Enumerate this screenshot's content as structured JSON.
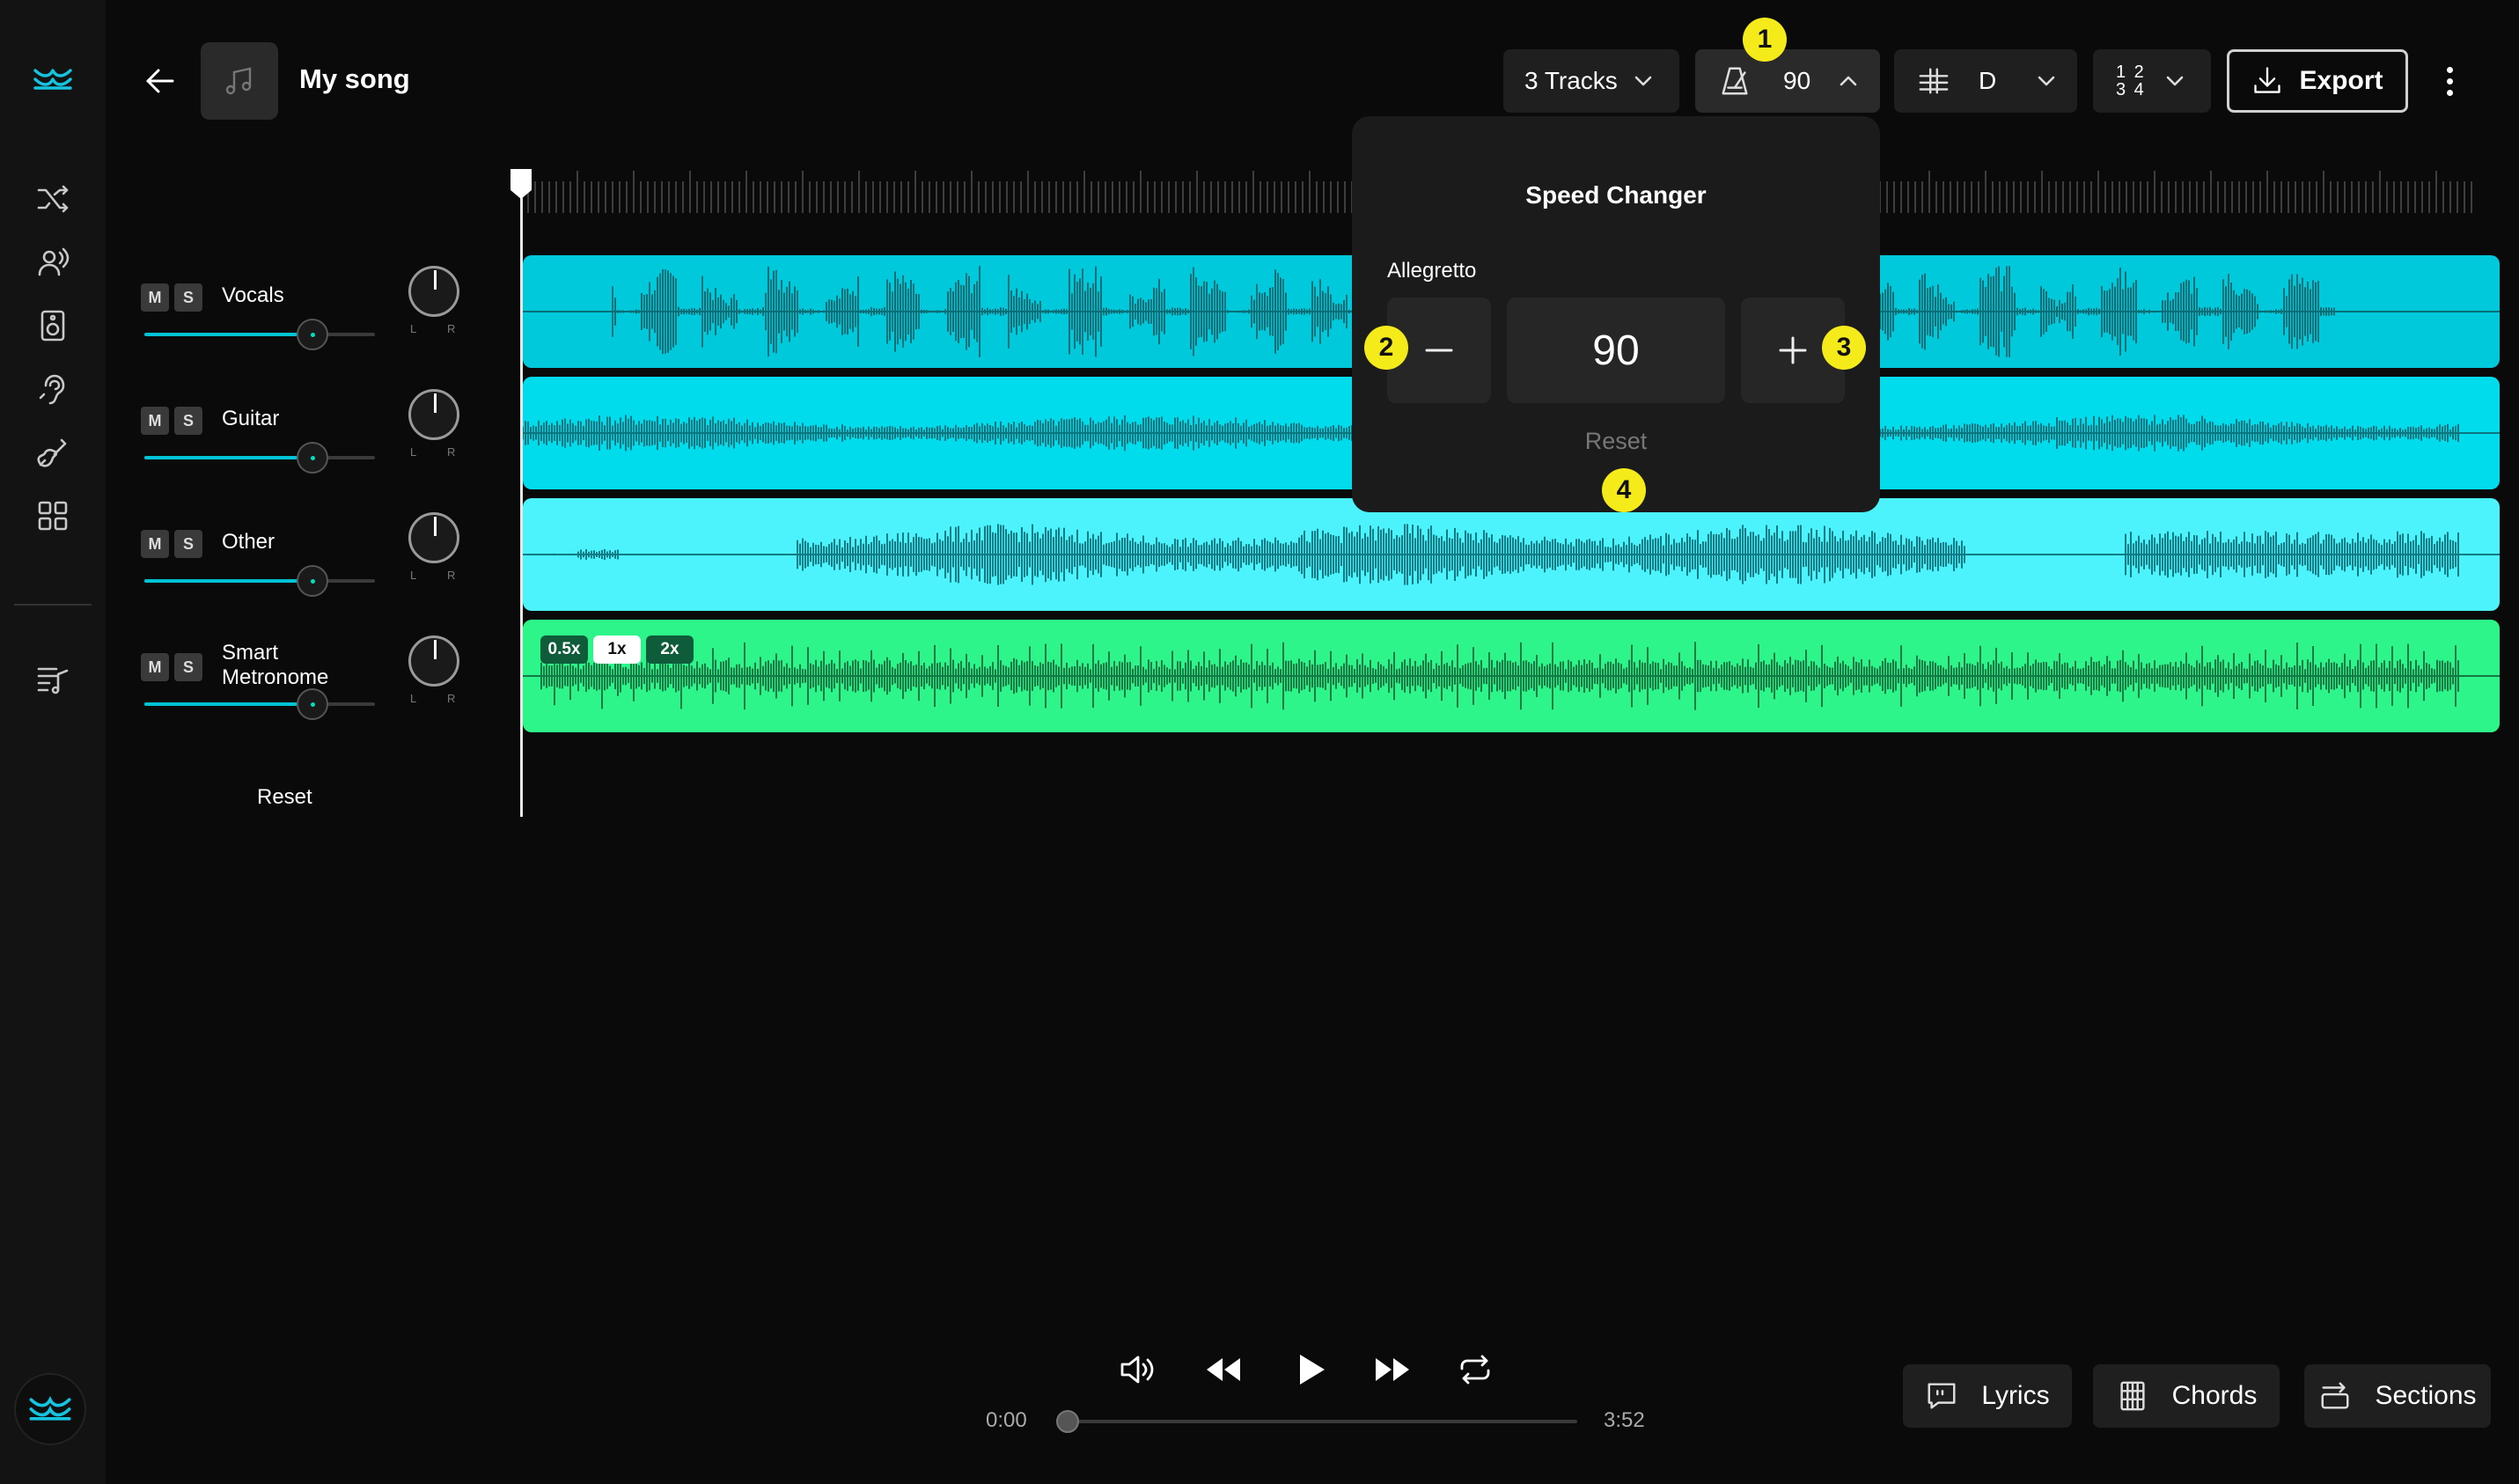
{
  "header": {
    "song_title": "My song",
    "tracks_label": "3 Tracks",
    "tempo_value": "90",
    "key_value": "D",
    "time_signature_top": "1 2",
    "time_signature_bottom": "3 4",
    "export_label": "Export"
  },
  "sidebar": {
    "items": [
      "logo-icon",
      "shuffle-icon",
      "voice-icon",
      "speaker-icon",
      "ear-icon",
      "guitar-icon",
      "grid-icon",
      "playlist-icon"
    ]
  },
  "tracks": [
    {
      "name": "Vocals",
      "mute": "M",
      "solo": "S",
      "volume": 0.72,
      "pan_left": "L",
      "pan_right": "R",
      "color": "#00c9dc"
    },
    {
      "name": "Guitar",
      "mute": "M",
      "solo": "S",
      "volume": 0.72,
      "pan_left": "L",
      "pan_right": "R",
      "color": "#00dcec"
    },
    {
      "name": "Other",
      "mute": "M",
      "solo": "S",
      "volume": 0.72,
      "pan_left": "L",
      "pan_right": "R",
      "color": "#4cf2fc"
    },
    {
      "name": "Smart Metronome",
      "mute": "M",
      "solo": "S",
      "volume": 0.72,
      "pan_left": "L",
      "pan_right": "R",
      "color": "#2ef58a"
    }
  ],
  "mixer_reset_label": "Reset",
  "metronome_speeds": [
    "0.5x",
    "1x",
    "2x"
  ],
  "metronome_selected_speed": "1x",
  "speed_changer": {
    "title": "Speed Changer",
    "tempo_name": "Allegretto",
    "value": "90",
    "reset_label": "Reset"
  },
  "badges": [
    "1",
    "2",
    "3",
    "4"
  ],
  "transport": {
    "current_time": "0:00",
    "total_time": "3:52",
    "progress": 0
  },
  "bottom_buttons": {
    "lyrics": "Lyrics",
    "chords": "Chords",
    "sections": "Sections"
  },
  "colors": {
    "accent": "#00c4d6",
    "badge": "#f5ea1a",
    "background": "#0a0a0a"
  }
}
